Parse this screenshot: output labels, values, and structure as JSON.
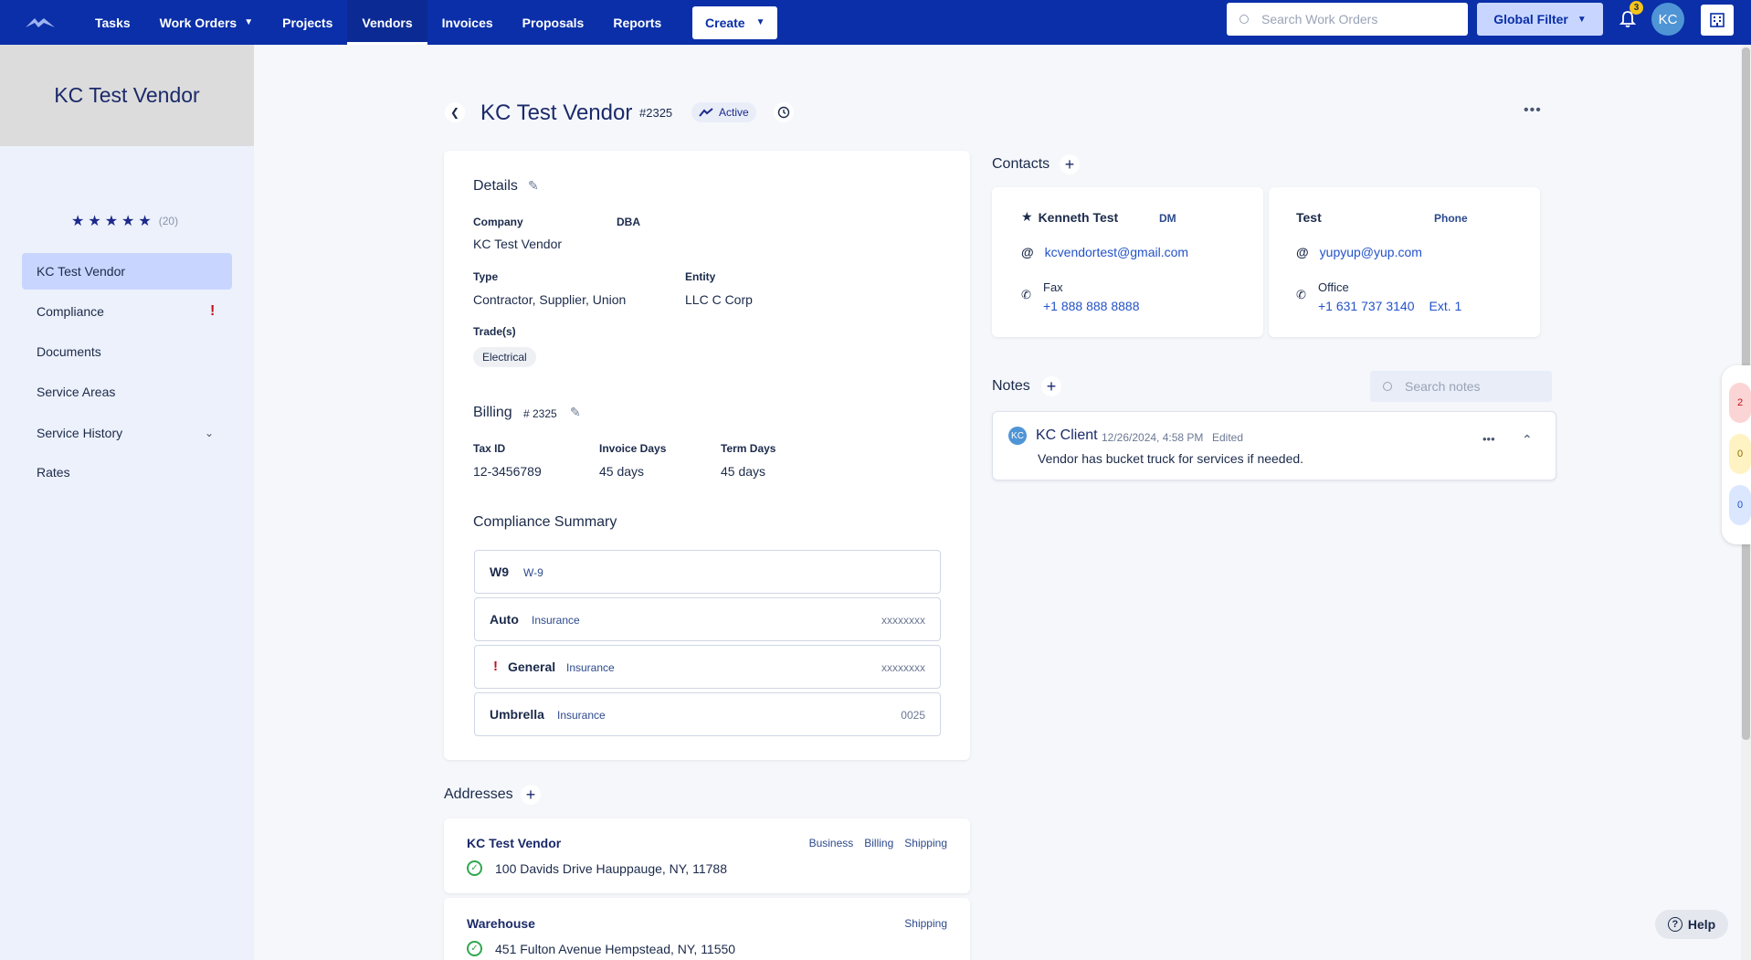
{
  "nav": {
    "items": [
      {
        "label": "Tasks"
      },
      {
        "label": "Work Orders"
      },
      {
        "label": "Projects"
      },
      {
        "label": "Vendors"
      },
      {
        "label": "Invoices"
      },
      {
        "label": "Proposals"
      },
      {
        "label": "Reports"
      }
    ],
    "create_label": "Create",
    "search_placeholder": "Search Work Orders",
    "global_filter_label": "Global Filter",
    "notifications_count": "3",
    "avatar_initials": "KC"
  },
  "sidebar": {
    "vendor_name": "KC Test Vendor",
    "rating_stars": 5,
    "rating_count": "(20)",
    "items": [
      {
        "label": "KC Test Vendor"
      },
      {
        "label": "Compliance"
      },
      {
        "label": "Documents"
      },
      {
        "label": "Service Areas"
      },
      {
        "label": "Service History"
      },
      {
        "label": "Rates"
      }
    ],
    "compliance_alert": "!"
  },
  "header": {
    "title": "KC Test Vendor",
    "vendor_number": "#2325",
    "status": "Active"
  },
  "details": {
    "title": "Details",
    "company_label": "Company",
    "company_value": "KC Test Vendor",
    "dba_label": "DBA",
    "type_label": "Type",
    "type_value": "Contractor, Supplier, Union",
    "entity_label": "Entity",
    "entity_value": "LLC C Corp",
    "trades_label": "Trade(s)",
    "trade_chip": "Electrical"
  },
  "billing": {
    "title": "Billing",
    "number": "# 2325",
    "tax_id_label": "Tax ID",
    "tax_id_value": "12-3456789",
    "invoice_days_label": "Invoice Days",
    "invoice_days_value": "45 days",
    "term_days_label": "Term Days",
    "term_days_value": "45 days"
  },
  "compliance_summary": {
    "title": "Compliance Summary",
    "rows": [
      {
        "name": "W9",
        "type": "W-9",
        "code": ""
      },
      {
        "name": "Auto",
        "type": "Insurance",
        "code": "xxxxxxxx"
      },
      {
        "name": "General",
        "type": "Insurance",
        "code": "xxxxxxxx",
        "warning": "!"
      },
      {
        "name": "Umbrella",
        "type": "Insurance",
        "code": "0025"
      }
    ]
  },
  "addresses": {
    "title": "Addresses",
    "items": [
      {
        "name": "KC Test Vendor",
        "tags": [
          "Business",
          "Billing",
          "Shipping"
        ],
        "address": "100 Davids Drive Hauppauge, NY, 11788"
      },
      {
        "name": "Warehouse",
        "tags": [
          "Shipping"
        ],
        "address": "451 Fulton Avenue Hempstead, NY, 11550"
      }
    ]
  },
  "contacts": {
    "title": "Contacts",
    "items": [
      {
        "name": "Kenneth Test",
        "role": "DM",
        "email": "kcvendortest@gmail.com",
        "phone_type": "Fax",
        "phone": "+1 888 888 8888",
        "ext": ""
      },
      {
        "name": "Test",
        "role": "Phone",
        "email": "yupyup@yup.com",
        "phone_type": "Office",
        "phone": "+1 631 737 3140",
        "ext": "Ext. 1"
      }
    ]
  },
  "notes": {
    "title": "Notes",
    "search_placeholder": "Search notes",
    "items": [
      {
        "author_initials": "KC",
        "author": "KC Client",
        "timestamp": "12/26/2024, 4:58 PM",
        "edited": "Edited",
        "text": "Vendor has bucket truck for services if needed."
      }
    ]
  },
  "right_rail": {
    "pills": [
      "2",
      "0",
      "0"
    ]
  },
  "help_label": "Help",
  "colors": {
    "nav_bg": "#0a2fa8",
    "accent": "#2352c8",
    "alert": "#c0121b",
    "success": "#2fa84f"
  }
}
